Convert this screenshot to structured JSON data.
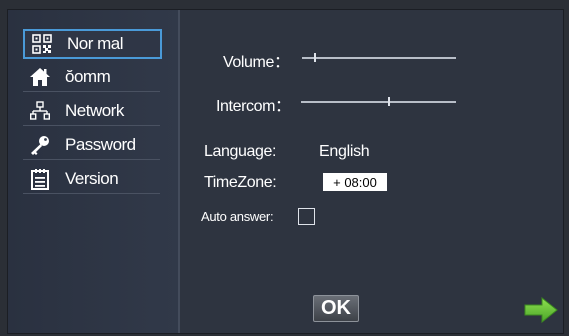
{
  "sidebar": {
    "items": [
      {
        "label": "Nor mal",
        "icon": "qr-code-icon",
        "selected": true
      },
      {
        "label": "ŏomm",
        "icon": "home-icon",
        "selected": false
      },
      {
        "label": "Network",
        "icon": "network-icon",
        "selected": false
      },
      {
        "label": "Password",
        "icon": "key-icon",
        "selected": false
      },
      {
        "label": "Version",
        "icon": "document-icon",
        "selected": false
      }
    ]
  },
  "settings": {
    "volume_label": "Volume：",
    "volume_level": 0.08,
    "intercom_label": "Intercom：",
    "intercom_level": 0.56,
    "language_label": "Language:",
    "language_value": "English",
    "timezone_label": "TimeZone:",
    "timezone_value": "+ 08:00",
    "auto_answer_label": "Auto answer:",
    "auto_answer_checked": false
  },
  "footer": {
    "ok_label": "OK",
    "next_icon": "arrow-right-icon"
  },
  "colors": {
    "background": "#2e3440",
    "selected_border": "#4a9ad8",
    "next_arrow": "#6fc63a"
  }
}
